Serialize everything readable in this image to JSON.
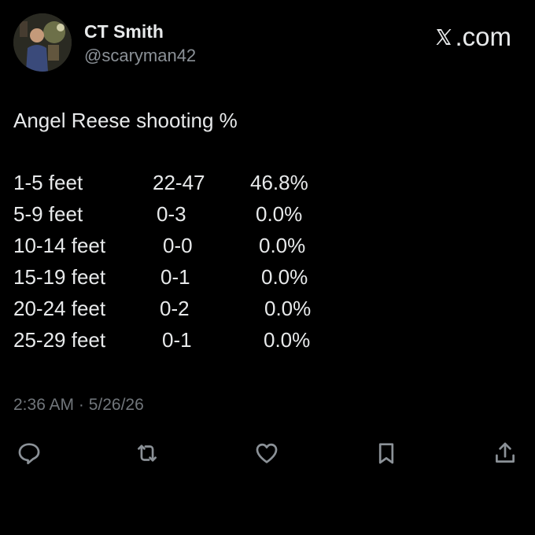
{
  "author": {
    "display_name": "CT Smith",
    "handle": "@scaryman42"
  },
  "brand": {
    "label": ".com",
    "icon": "x-logo-icon"
  },
  "tweet": {
    "text": "Angel Reese shooting %",
    "stats": [
      {
        "range": "1-5 feet",
        "made_attempted": "22-47",
        "pct": "46.8%"
      },
      {
        "range": "5-9 feet",
        "made_attempted": "0-3",
        "pct": "0.0%"
      },
      {
        "range": "10-14 feet",
        "made_attempted": "0-0",
        "pct": "0.0%"
      },
      {
        "range": "15-19 feet",
        "made_attempted": "0-1",
        "pct": "0.0%"
      },
      {
        "range": "20-24 feet",
        "made_attempted": "0-2",
        "pct": "0.0%"
      },
      {
        "range": "25-29 feet",
        "made_attempted": "0-1",
        "pct": "0.0%"
      }
    ],
    "timestamp": "2:36 AM · 5/26/26"
  },
  "actions": [
    {
      "name": "reply",
      "icon": "reply-icon"
    },
    {
      "name": "repost",
      "icon": "repost-icon"
    },
    {
      "name": "like",
      "icon": "heart-icon"
    },
    {
      "name": "bookmark",
      "icon": "bookmark-icon"
    },
    {
      "name": "share",
      "icon": "share-icon"
    }
  ],
  "colors": {
    "background": "#000000",
    "primary_text": "#e7e9ea",
    "secondary_text": "#71767b",
    "icon": "#8b9197"
  }
}
